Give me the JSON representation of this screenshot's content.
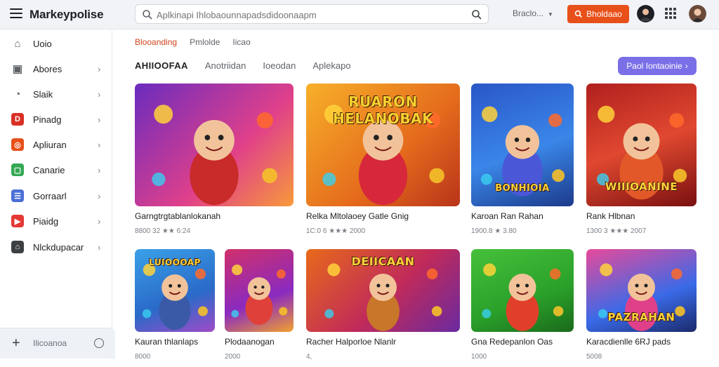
{
  "header": {
    "brand": "Markeypolise",
    "search_placeholder": "Aplkinapi Ihlobaounnapadsdidoonaapm",
    "lang": "Braclo...",
    "signin_label": "Bholdaao",
    "icons": [
      "menu-icon",
      "search-icon",
      "mic-icon",
      "user-icon",
      "apps-grid-icon"
    ]
  },
  "sidebar": {
    "items": [
      {
        "label": "Uoio",
        "icon": "home-icon",
        "color": "#5f6368",
        "glyph": "⌂"
      },
      {
        "label": "Abores",
        "icon": "box-icon",
        "color": "#5f6368",
        "glyph": "▣"
      },
      {
        "label": "Slaik",
        "icon": "compass-icon",
        "color": "#5f6368",
        "glyph": "◔"
      },
      {
        "label": "Pinadg",
        "icon": "d-icon",
        "color": "#d93025",
        "glyph": "D"
      },
      {
        "label": "Apliuran",
        "icon": "app-icon",
        "color": "#e8501a",
        "glyph": "◎"
      },
      {
        "label": "Canarie",
        "icon": "chat-icon",
        "color": "#34a853",
        "glyph": "▢"
      },
      {
        "label": "Gorraarl",
        "icon": "doc-icon",
        "color": "#4a6fd6",
        "glyph": "☰"
      },
      {
        "label": "Piaidg",
        "icon": "play-icon",
        "color": "#e53935",
        "glyph": "▶"
      },
      {
        "label": "Nlckdupacar",
        "icon": "store-icon",
        "color": "#3c4043",
        "glyph": "⌂"
      }
    ],
    "footer_label": "Ilicoanoa"
  },
  "filters": [
    "Blooanding",
    "Pmlolde",
    "Iicao"
  ],
  "tabs": [
    "AHIIOOFAA",
    "Anotriidan",
    "Ioeodan",
    "Aplekapo"
  ],
  "see_all_label": "Paol Iontaoinie",
  "cards": [
    {
      "title": "Garngtrgtablanlokanah",
      "meta": "8800 32 ★★ 6:24",
      "banner": ""
    },
    {
      "title": "Relka Mltolaoey Gatle Gnig",
      "meta": "1C:0 6 ★★★ 2000",
      "banner": "RUARON HELANOBAK"
    },
    {
      "title": "Karoan Ran Rahan",
      "meta": "1900.8 ★ 3.80",
      "banner": "BONHIOIA"
    },
    {
      "title": "Rank Hlbnan",
      "meta": "1300 3 ★★★ 2007",
      "banner": "WIIIOANINE"
    },
    {
      "title": "Kauran thlanlaps",
      "meta": "8000",
      "banner": "LUIOOOAP"
    },
    {
      "title": "Plodaanogan",
      "meta": "2000",
      "banner": ""
    },
    {
      "title": "Racher Halporloe Nlanlr",
      "meta": "4,",
      "banner": "DEIICAAN"
    },
    {
      "title": "Gna Redepanlon Oas",
      "meta": "1000",
      "banner": ""
    },
    {
      "title": "Karacdienlle 6RJ pads",
      "meta": "5008",
      "banner": "PAZRAHAN"
    }
  ]
}
